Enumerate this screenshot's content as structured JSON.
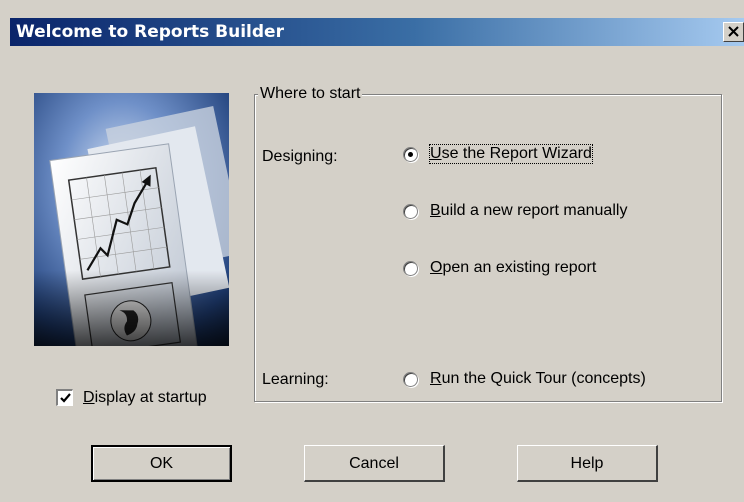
{
  "window": {
    "title": "Welcome to Reports Builder",
    "close_icon": "close-icon"
  },
  "startup": {
    "label": "Display at startup",
    "checked": true
  },
  "group": {
    "legend": "Where to start",
    "designing_label": "Designing:",
    "learning_label": "Learning:",
    "options": [
      {
        "label": "Use the Report Wizard",
        "selected": true
      },
      {
        "label": "Build a new report manually",
        "selected": false
      },
      {
        "label": "Open an existing report",
        "selected": false
      },
      {
        "label": "Run the Quick Tour (concepts)",
        "selected": false
      }
    ]
  },
  "buttons": {
    "ok": "OK",
    "cancel": "Cancel",
    "help": "Help"
  },
  "colors": {
    "title_start": "#0a246a",
    "title_end": "#a6caf0",
    "face": "#d4d0c8"
  }
}
